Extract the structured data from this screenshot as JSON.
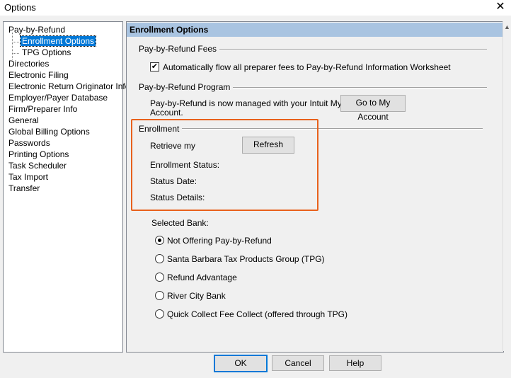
{
  "window": {
    "title": "Options",
    "close_glyph": "✕"
  },
  "tree": {
    "items": [
      {
        "label": "Pay-by-Refund"
      },
      {
        "label": "Enrollment Options"
      },
      {
        "label": "TPG Options"
      },
      {
        "label": "Directories"
      },
      {
        "label": "Electronic Filing"
      },
      {
        "label": "Electronic Return Originator Info"
      },
      {
        "label": "Employer/Payer Database"
      },
      {
        "label": "Firm/Preparer Info"
      },
      {
        "label": "General"
      },
      {
        "label": "Global Billing Options"
      },
      {
        "label": "Passwords"
      },
      {
        "label": "Printing Options"
      },
      {
        "label": "Task Scheduler"
      },
      {
        "label": "Tax Import"
      },
      {
        "label": "Transfer"
      }
    ],
    "selected": "Enrollment Options"
  },
  "panel": {
    "header": "Enrollment Options",
    "fees_group": "Pay-by-Refund Fees",
    "fees_checkbox_label": "Automatically flow all preparer fees to Pay-by-Refund Information Worksheet",
    "fees_checkbox_checked": true,
    "program_group": "Pay-by-Refund Program",
    "program_text_1": "Pay-by-Refund is now managed with your Intuit My",
    "program_text_2": "Account.",
    "goto_account_button": "Go to My Account",
    "enrollment_group": "Enrollment",
    "retrieve_label": "Retrieve my",
    "refresh_button": "Refresh",
    "status_label": "Enrollment Status:",
    "status_date_label": "Status Date:",
    "status_details_label": "Status Details:",
    "selected_bank_label": "Selected Bank:",
    "banks": [
      {
        "label": "Not Offering Pay-by-Refund",
        "selected": true
      },
      {
        "label": "Santa Barbara Tax Products Group (TPG)",
        "selected": false
      },
      {
        "label": "Refund Advantage",
        "selected": false
      },
      {
        "label": "River City Bank",
        "selected": false
      },
      {
        "label": "Quick Collect Fee Collect (offered through TPG)",
        "selected": false
      }
    ],
    "highlight_color": "#e8611c"
  },
  "footer": {
    "ok": "OK",
    "cancel": "Cancel",
    "help": "Help"
  }
}
